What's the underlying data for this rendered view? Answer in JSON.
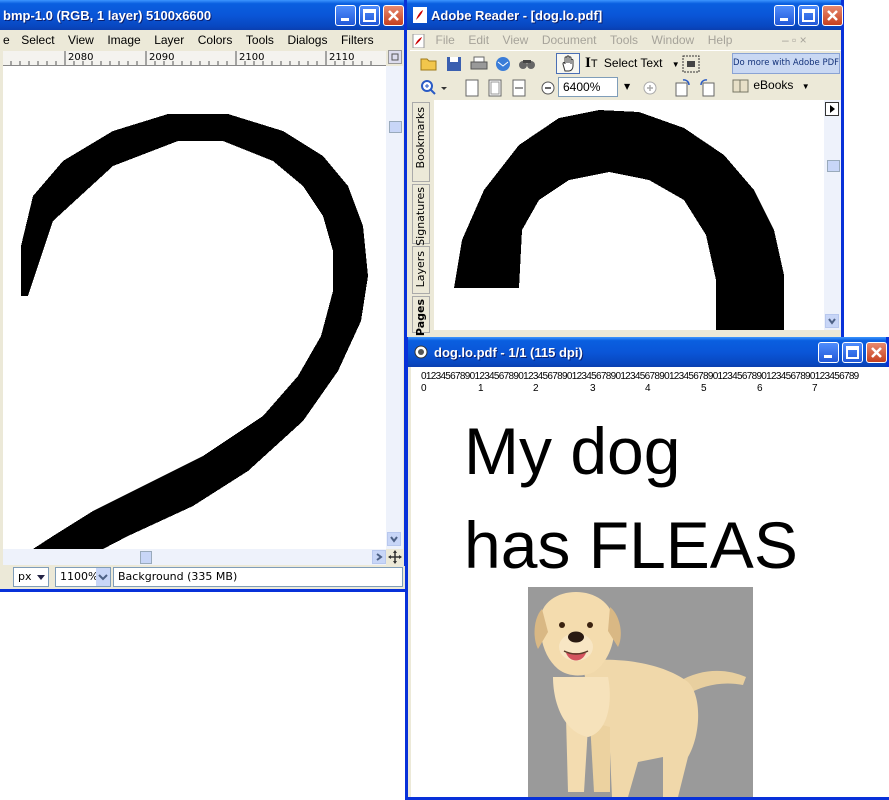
{
  "gimp": {
    "title": "bmp-1.0 (RGB, 1 layer) 5100x6600",
    "menu": [
      "Select",
      "View",
      "Image",
      "Layer",
      "Colors",
      "Tools",
      "Dialogs",
      "Filters"
    ],
    "menu_first_char": "e",
    "ruler_labels": [
      "2080",
      "2090",
      "2100",
      "2110"
    ],
    "unit": "px",
    "zoom": "1100%",
    "status": "Background (335 MB)"
  },
  "reader": {
    "title": "Adobe Reader - [dog.lo.pdf]",
    "menu": [
      "File",
      "Edit",
      "View",
      "Document",
      "Tools",
      "Window",
      "Help"
    ],
    "select_text": "Select Text",
    "do_more": "Do more with Adobe PDF",
    "zoom": "6400%",
    "ebooks": "eBooks",
    "side_tabs": [
      "Bookmarks",
      "Signatures",
      "Layers",
      "Pages"
    ]
  },
  "viewer": {
    "title": "dog.lo.pdf - 1/1 (115 dpi)",
    "ruler_digits": "012345678901234567890123456789012345678901234567890123456789012345678901234567890123456789",
    "ruler_tens": [
      "0",
      "1",
      "2",
      "3",
      "4",
      "5",
      "6",
      "7"
    ],
    "headline_1": "My dog",
    "headline_2": "has FLEAS"
  },
  "colors": {
    "xp_title": "#0a56d8",
    "xp_frame": "#0831d9",
    "photo_bg": "#9a9a9a"
  }
}
